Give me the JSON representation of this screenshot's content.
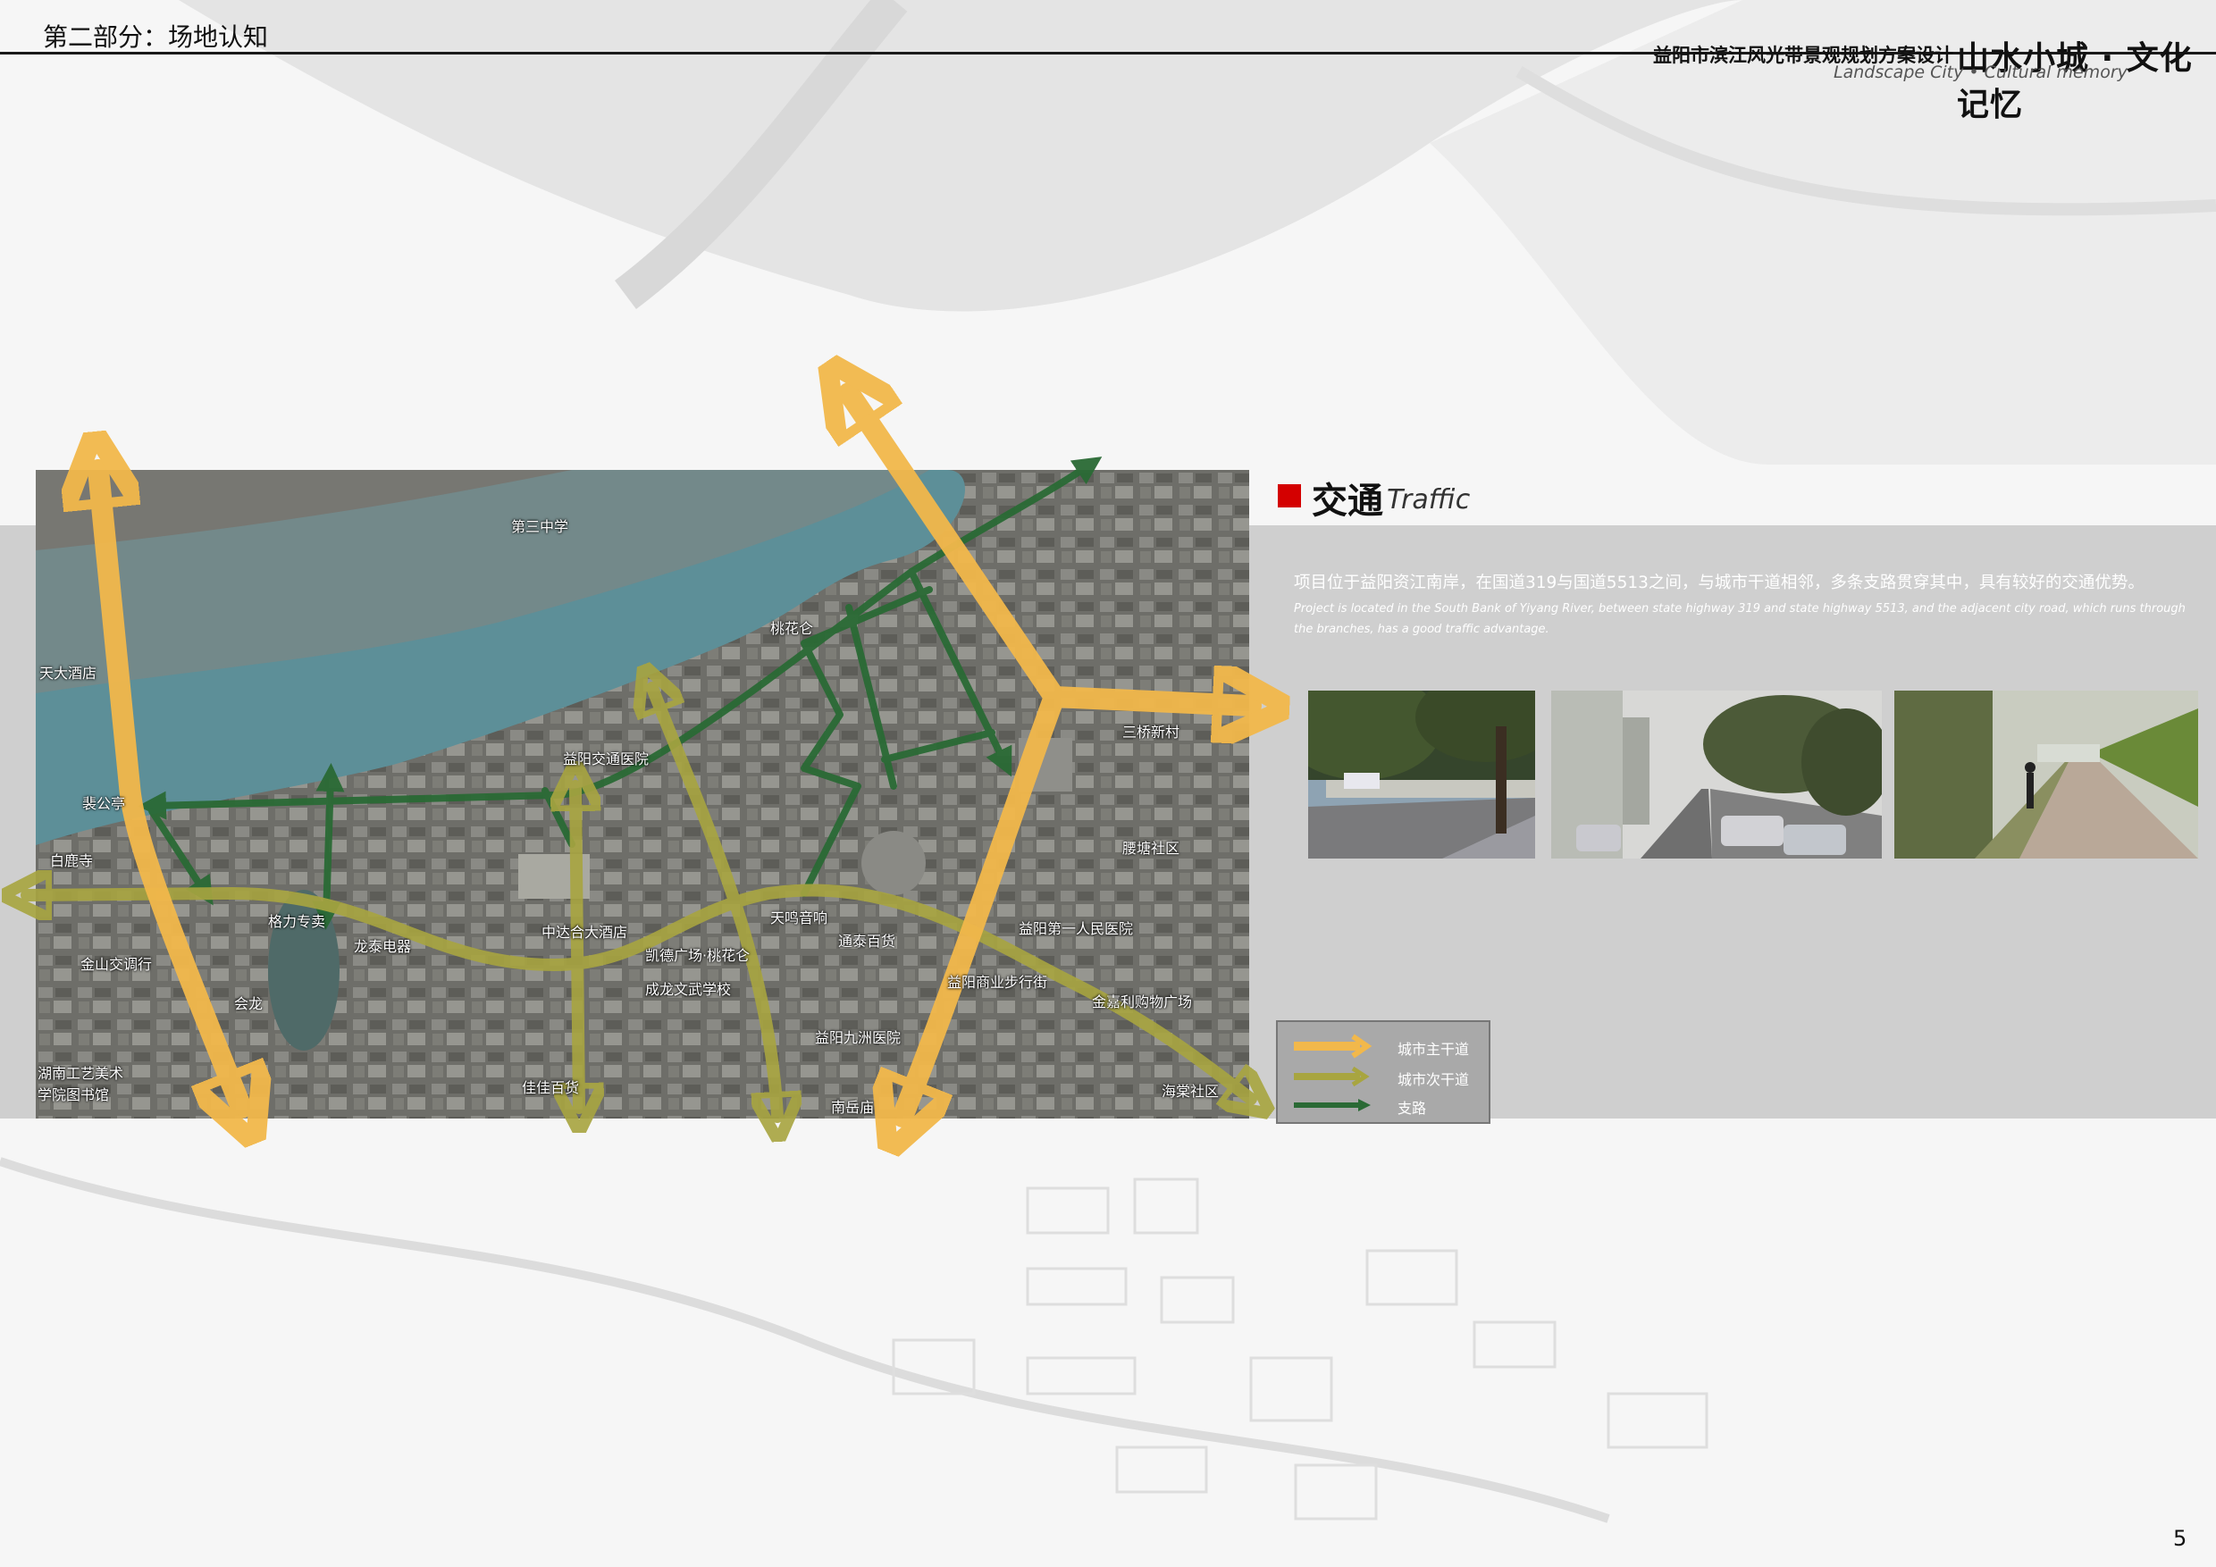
{
  "header": {
    "section_label": "第二部分：场地认知",
    "project_title": "益阳市滨江风光带景观规划方案设计",
    "slogan": "山水小城 · 文化记忆",
    "slogan_en": "Landscape City • Cultural memory"
  },
  "traffic": {
    "heading_cn": "交通",
    "heading_en": "Traffic",
    "description_cn": "项目位于益阳资江南岸，在国道319与国道5513之间，与城市干道相邻，多条支路贯穿其中，具有较好的交通优势。",
    "description_en": "Project is located in the South Bank of Yiyang River, between state highway 319 and state highway 5513, and the adjacent city road, which runs through the branches, has a good traffic advantage."
  },
  "map": {
    "labels": [
      "第三中学",
      "桃花仑",
      "益阳交通医院",
      "裴公亭",
      "白鹿寺",
      "天大酒店",
      "格力专卖",
      "龙泰电器",
      "金山交调行",
      "中达合大酒店",
      "凯德广场·桃花仑",
      "成龙文武学校",
      "天鸣音响",
      "通泰百货",
      "益阳第一人民医院",
      "益阳商业步行街",
      "金嘉利购物广场",
      "益阳九洲医院",
      "佳佳百货",
      "南岳庙",
      "三桥新村",
      "腰塘社区",
      "海棠社区",
      "湖南工艺美术学院图书馆",
      "会龙"
    ]
  },
  "legend": {
    "items": [
      {
        "label": "城市主干道",
        "color": "#f2b84b"
      },
      {
        "label": "城市次干道",
        "color": "#a8a540"
      },
      {
        "label": "支路",
        "color": "#2a6a35"
      }
    ]
  },
  "page_number": "5"
}
